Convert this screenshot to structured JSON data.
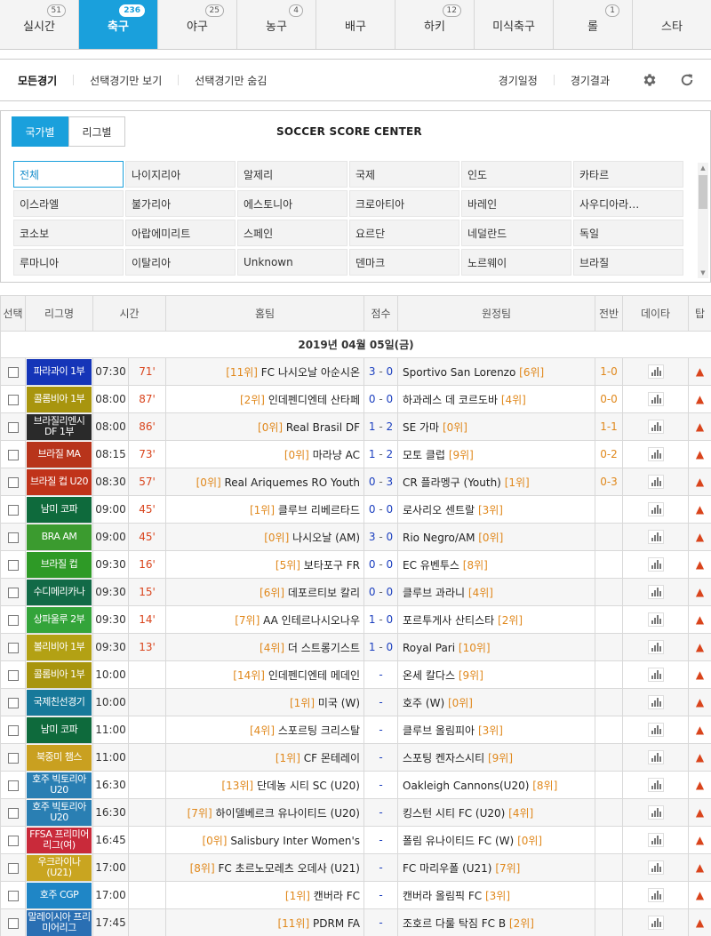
{
  "sport_tabs": [
    {
      "label": "실시간",
      "badge": "51",
      "active": false
    },
    {
      "label": "축구",
      "badge": "236",
      "active": true
    },
    {
      "label": "야구",
      "badge": "25",
      "active": false
    },
    {
      "label": "농구",
      "badge": "4",
      "active": false
    },
    {
      "label": "배구",
      "badge": "",
      "active": false
    },
    {
      "label": "하키",
      "badge": "12",
      "active": false
    },
    {
      "label": "미식축구",
      "badge": "",
      "active": false
    },
    {
      "label": "롤",
      "badge": "1",
      "active": false
    },
    {
      "label": "스타",
      "badge": "",
      "active": false
    }
  ],
  "filter_bar": {
    "all_label": "모든경기",
    "show_selected_label": "선택경기만 보기",
    "hide_selected_label": "선택경기만 숨김",
    "schedule_label": "경기일정",
    "results_label": "경기결과",
    "settings_icon": "gear-icon",
    "refresh_icon": "refresh-icon"
  },
  "selector": {
    "tab_country": "국가별",
    "tab_league": "리그별",
    "title": "SOCCER SCORE CENTER",
    "countries": [
      "전체",
      "나이지리아",
      "알제리",
      "국제",
      "인도",
      "카타르",
      "이스라엘",
      "불가리아",
      "에스토니아",
      "크로아티아",
      "바레인",
      "사우디아라…",
      "코소보",
      "아랍에미리트",
      "스페인",
      "요르단",
      "네덜란드",
      "독일",
      "루마니아",
      "이탈리아",
      "Unknown",
      "덴마크",
      "노르웨이",
      "브라질"
    ]
  },
  "table": {
    "headers": {
      "select": "선택",
      "league": "리그명",
      "time": "시간",
      "home": "홈팀",
      "score": "점수",
      "away": "원정팀",
      "half": "전반",
      "data": "데이타",
      "tip": "탑"
    },
    "date_label": "2019년 04월 05일(금)",
    "colors": {
      "rank": "#e0881c",
      "minute": "#d9441c",
      "score": "#1b3fbf",
      "accent": "#1aa0dc"
    },
    "rows": [
      {
        "league": "파라과이 1부",
        "league_color": "#1535b8",
        "time": "07:30",
        "minute": "71'",
        "home_rank": "[11위]",
        "home": "FC 나시오날 아순시온",
        "score_home": "3",
        "score_away": "0",
        "away": "Sportivo San Lorenzo",
        "away_rank": "[6위]",
        "half": "1-0"
      },
      {
        "league": "콜롬비아 1부",
        "league_color": "#a8950e",
        "time": "08:00",
        "minute": "87'",
        "home_rank": "[2위]",
        "home": "인데펜디엔테 산타페",
        "score_home": "0",
        "score_away": "0",
        "away": "하과레스 데 코르도바",
        "away_rank": "[4위]",
        "half": "0-0"
      },
      {
        "league": "브라질리엔시 DF 1부",
        "league_color": "#2a2a2a",
        "time": "08:00",
        "minute": "86'",
        "home_rank": "[0위]",
        "home": "Real Brasil DF",
        "score_home": "1",
        "score_away": "2",
        "away": "SE 가마",
        "away_rank": "[0위]",
        "half": "1-1"
      },
      {
        "league": "브라질 MA",
        "league_color": "#b8341b",
        "time": "08:15",
        "minute": "73'",
        "home_rank": "[0위]",
        "home": "마라냥 AC",
        "score_home": "1",
        "score_away": "2",
        "away": "모토 클럽",
        "away_rank": "[9위]",
        "half": "0-2"
      },
      {
        "league": "브라질 컵 U20",
        "league_color": "#c0331a",
        "time": "08:30",
        "minute": "57'",
        "home_rank": "[0위]",
        "home": "Real Ariquemes RO Youth",
        "score_home": "0",
        "score_away": "3",
        "away": "CR 플라멩구 (Youth)",
        "away_rank": "[1위]",
        "half": "0-3"
      },
      {
        "league": "남미 코파",
        "league_color": "#0e6a3c",
        "time": "09:00",
        "minute": "45'",
        "home_rank": "[1위]",
        "home": "클루브 리베르타드",
        "score_home": "0",
        "score_away": "0",
        "away": "로사리오 센트랄",
        "away_rank": "[3위]",
        "half": ""
      },
      {
        "league": "BRA AM",
        "league_color": "#3b9b2f",
        "time": "09:00",
        "minute": "45'",
        "home_rank": "[0위]",
        "home": "나시오날 (AM)",
        "score_home": "3",
        "score_away": "0",
        "away": "Rio Negro/AM",
        "away_rank": "[0위]",
        "half": ""
      },
      {
        "league": "브라질 컵",
        "league_color": "#2e9a26",
        "time": "09:30",
        "minute": "16'",
        "home_rank": "[5위]",
        "home": "보타포구 FR",
        "score_home": "0",
        "score_away": "0",
        "away": "EC 유벤투스",
        "away_rank": "[8위]",
        "half": ""
      },
      {
        "league": "수디메리카나",
        "league_color": "#126a47",
        "time": "09:30",
        "minute": "15'",
        "home_rank": "[6위]",
        "home": "데포르티보 칼리",
        "score_home": "0",
        "score_away": "0",
        "away": "클루브 과라니",
        "away_rank": "[4위]",
        "half": ""
      },
      {
        "league": "상파울루 2부",
        "league_color": "#33a43a",
        "time": "09:30",
        "minute": "14'",
        "home_rank": "[7위]",
        "home": "AA 인테르나시오나우",
        "score_home": "1",
        "score_away": "0",
        "away": "포르투게사 산티스타",
        "away_rank": "[2위]",
        "half": ""
      },
      {
        "league": "볼리비아 1부",
        "league_color": "#b3a114",
        "time": "09:30",
        "minute": "13'",
        "home_rank": "[4위]",
        "home": "더 스트롱기스트",
        "score_home": "1",
        "score_away": "0",
        "away": "Royal Pari",
        "away_rank": "[10위]",
        "half": ""
      },
      {
        "league": "콜롬비아 1부",
        "league_color": "#a8950e",
        "time": "10:00",
        "minute": "",
        "home_rank": "[14위]",
        "home": "인데펜디엔테 메데인",
        "score_home": "",
        "score_away": "",
        "away": "온세 칼다스",
        "away_rank": "[9위]",
        "half": ""
      },
      {
        "league": "국제친선경기",
        "league_color": "#17799a",
        "time": "10:00",
        "minute": "",
        "home_rank": "[1위]",
        "home": "미국 (W)",
        "score_home": "",
        "score_away": "",
        "away": "호주 (W)",
        "away_rank": "[0위]",
        "half": ""
      },
      {
        "league": "남미 코파",
        "league_color": "#0e6a3c",
        "time": "11:00",
        "minute": "",
        "home_rank": "[4위]",
        "home": "스포르팅 크리스탈",
        "score_home": "",
        "score_away": "",
        "away": "클루브 올림피아",
        "away_rank": "[3위]",
        "half": ""
      },
      {
        "league": "북중미 챔스",
        "league_color": "#c9a020",
        "time": "11:00",
        "minute": "",
        "home_rank": "[1위]",
        "home": "CF 몬테레이",
        "score_home": "",
        "score_away": "",
        "away": "스포팅 켄자스시티",
        "away_rank": "[9위]",
        "half": ""
      },
      {
        "league": "호주 빅토리아 U20",
        "league_color": "#2a7fb3",
        "time": "16:30",
        "minute": "",
        "home_rank": "[13위]",
        "home": "단데농 시티 SC (U20)",
        "score_home": "",
        "score_away": "",
        "away": "Oakleigh Cannons(U20)",
        "away_rank": "[8위]",
        "half": ""
      },
      {
        "league": "호주 빅토리아 U20",
        "league_color": "#2a7fb3",
        "time": "16:30",
        "minute": "",
        "home_rank": "[7위]",
        "home": "하이델베르크 유나이티드 (U20)",
        "score_home": "",
        "score_away": "",
        "away": "킹스턴 시티 FC (U20)",
        "away_rank": "[4위]",
        "half": ""
      },
      {
        "league": "FFSA 프리미어리그(여)",
        "league_color": "#c92a3a",
        "time": "16:45",
        "minute": "",
        "home_rank": "[0위]",
        "home": "Salisbury Inter Women's",
        "score_home": "",
        "score_away": "",
        "away": "폴림 유나이티드 FC (W)",
        "away_rank": "[0위]",
        "half": ""
      },
      {
        "league": "우크라이나(U21)",
        "league_color": "#c9a520",
        "time": "17:00",
        "minute": "",
        "home_rank": "[8위]",
        "home": "FC 초르노모레츠 오데사 (U21)",
        "score_home": "",
        "score_away": "",
        "away": "FC 마리우폴 (U21)",
        "away_rank": "[7위]",
        "half": ""
      },
      {
        "league": "호주 CGP",
        "league_color": "#1f86c6",
        "time": "17:00",
        "minute": "",
        "home_rank": "[1위]",
        "home": "캔버라 FC",
        "score_home": "",
        "score_away": "",
        "away": "캔버라 올림픽 FC",
        "away_rank": "[3위]",
        "half": ""
      },
      {
        "league": "말레이시아 프리미어리그",
        "league_color": "#2a6fb3",
        "time": "17:45",
        "minute": "",
        "home_rank": "[11위]",
        "home": "PDRM FA",
        "score_home": "",
        "score_away": "",
        "away": "조호르 다룰 탁짐 FC B",
        "away_rank": "[2위]",
        "half": ""
      }
    ]
  }
}
